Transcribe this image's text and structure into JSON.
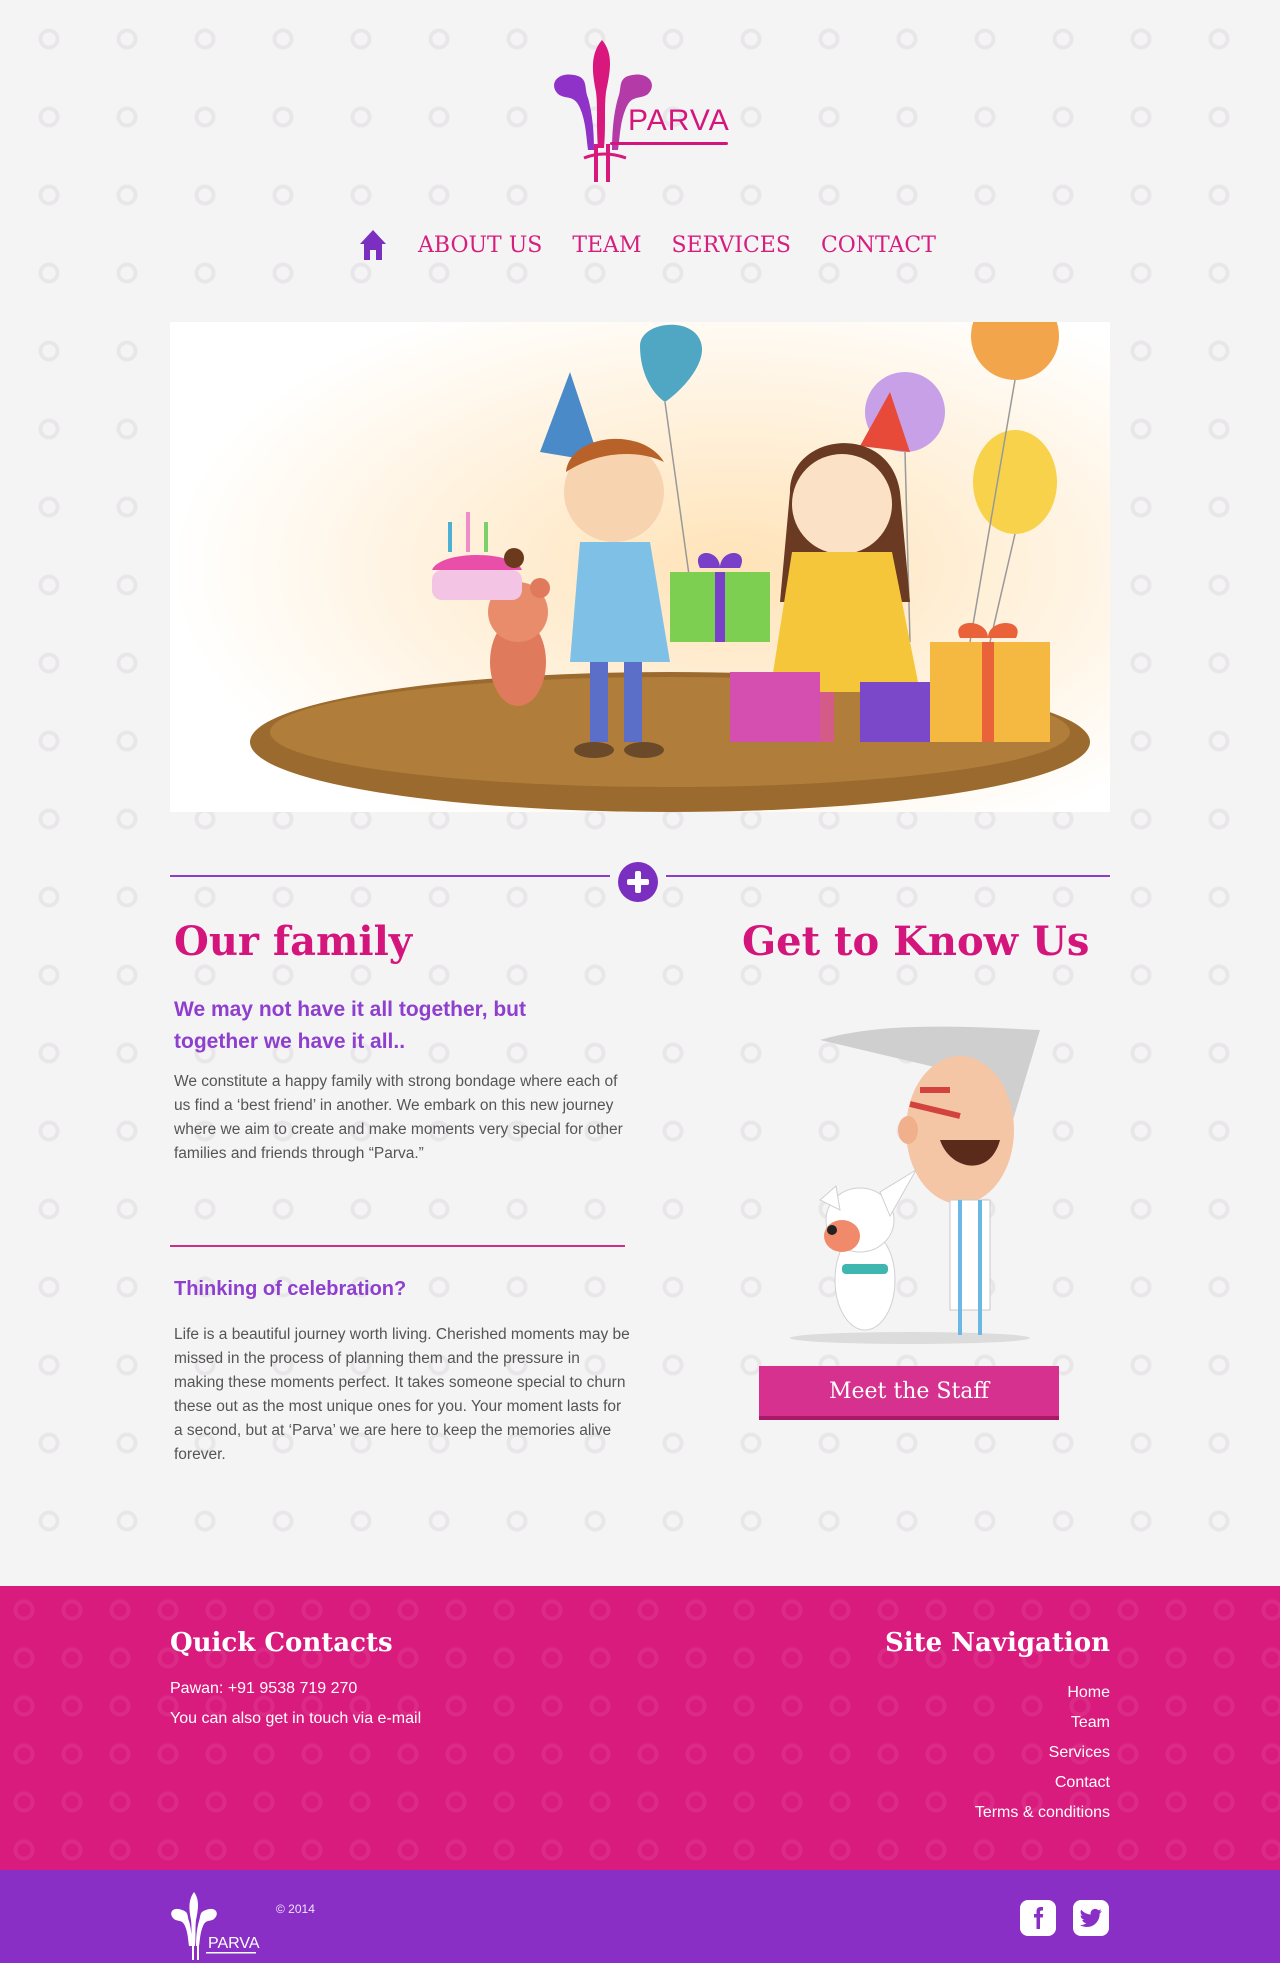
{
  "brand": {
    "name": "PARVA",
    "colors": {
      "pink": "#d4157c",
      "purple": "#8a2fc6",
      "background": "#f5f4f5"
    }
  },
  "nav": {
    "home_icon": "home-icon",
    "items": [
      {
        "label": "ABOUT US"
      },
      {
        "label": "TEAM"
      },
      {
        "label": "SERVICES"
      },
      {
        "label": "CONTACT"
      }
    ]
  },
  "family": {
    "title": "Our family",
    "subtitle": "We may not have it all together, but together we have it all..",
    "text": "We constitute a happy family with strong bondage where each of us find a ‘best friend’ in another. We embark on this new journey where we aim to create and make moments very special for other families and friends through “Parva.”"
  },
  "celebration": {
    "title": "Thinking of celebration?",
    "text": "Life is a beautiful journey worth living. Cherished moments may be missed in the process of planning them and the pressure in making these moments perfect. It takes someone special to churn these out as the most unique ones for you. Your moment lasts for a second, but at ‘Parva’ we are here to keep the memories alive forever."
  },
  "know": {
    "title": "Get to Know Us",
    "button": "Meet the Staff"
  },
  "footer": {
    "quick_title": "Quick Contacts",
    "phone": "Pawan: +91 9538 719 270",
    "email_line": "You can also get in touch via e-mail",
    "nav_title": "Site Navigation",
    "nav_links": [
      "Home",
      "Team",
      "Services",
      "Contact",
      "Terms & conditions"
    ]
  },
  "bottom": {
    "copyright": "© 2014",
    "social": [
      "facebook-icon",
      "twitter-icon"
    ]
  }
}
